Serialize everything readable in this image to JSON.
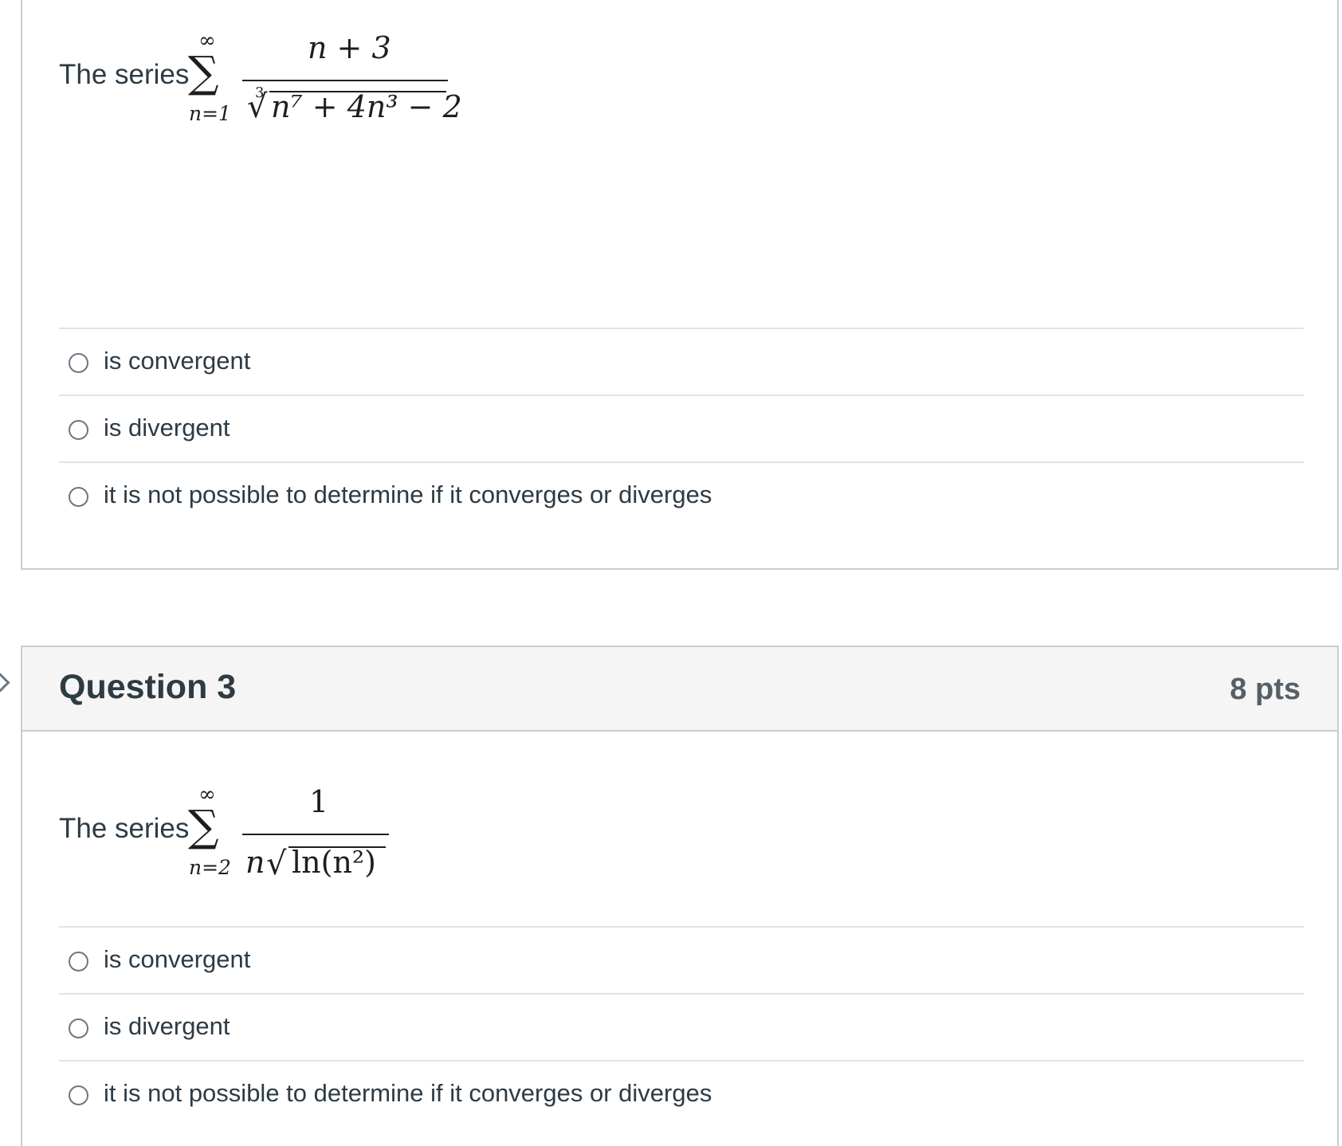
{
  "question2": {
    "stem_text": "The series",
    "math": {
      "sum_upper": "∞",
      "sum_lower": "n=1",
      "numerator": "n + 3",
      "denominator_root_index": "3",
      "denominator": "n⁷ + 4n³ − 2"
    },
    "answers": [
      {
        "label": "is convergent"
      },
      {
        "label": "is divergent"
      },
      {
        "label": "it is not possible to determine if it converges or diverges"
      }
    ]
  },
  "question3": {
    "title": "Question 3",
    "points": "8 pts",
    "stem_text": "The series",
    "math": {
      "sum_upper": "∞",
      "sum_lower": "n=2",
      "numerator": "1",
      "denominator_prefix": "n",
      "denominator_radicand": "ln(n²)"
    },
    "answers": [
      {
        "label": "is convergent"
      },
      {
        "label": "is divergent"
      },
      {
        "label": "it is not possible to determine if it converges or diverges"
      }
    ]
  }
}
